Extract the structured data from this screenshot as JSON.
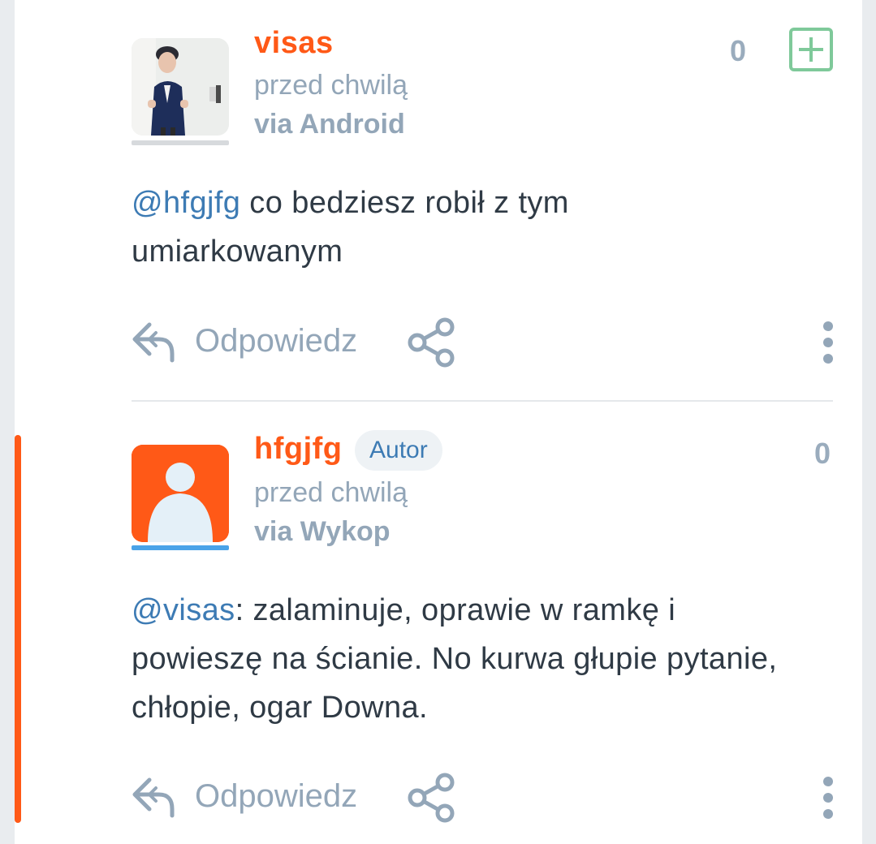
{
  "comments": [
    {
      "username": "visas",
      "time": "przed chwilą",
      "via": "via Android",
      "score": "0",
      "mention": "@hfgjfg",
      "text": " co bedziesz robił z tym umiarkowanym",
      "reply_label": "Odpowiedz",
      "avatar": "user-photo"
    },
    {
      "username": "hfgjfg",
      "badge": "Autor",
      "time": "przed chwilą",
      "via": "via Wykop",
      "score": "0",
      "mention": "@visas",
      "text": ": zalaminuje, oprawie w ramkę i powieszę na ścianie. No kurwa głupie pytanie, chłopie, ogar Downa.",
      "reply_label": "Odpowiedz",
      "avatar": "default-avatar"
    }
  ],
  "icons": {
    "reply": "reply-arrow-icon",
    "share": "share-icon",
    "more": "vertical-dots-icon",
    "plus": "plus-square-icon"
  },
  "colors": {
    "username": "#ff5917",
    "mention": "#3d7bb4",
    "muted": "#93a6b8",
    "plus": "#7fc99a",
    "thread_line": "#ff5917"
  }
}
